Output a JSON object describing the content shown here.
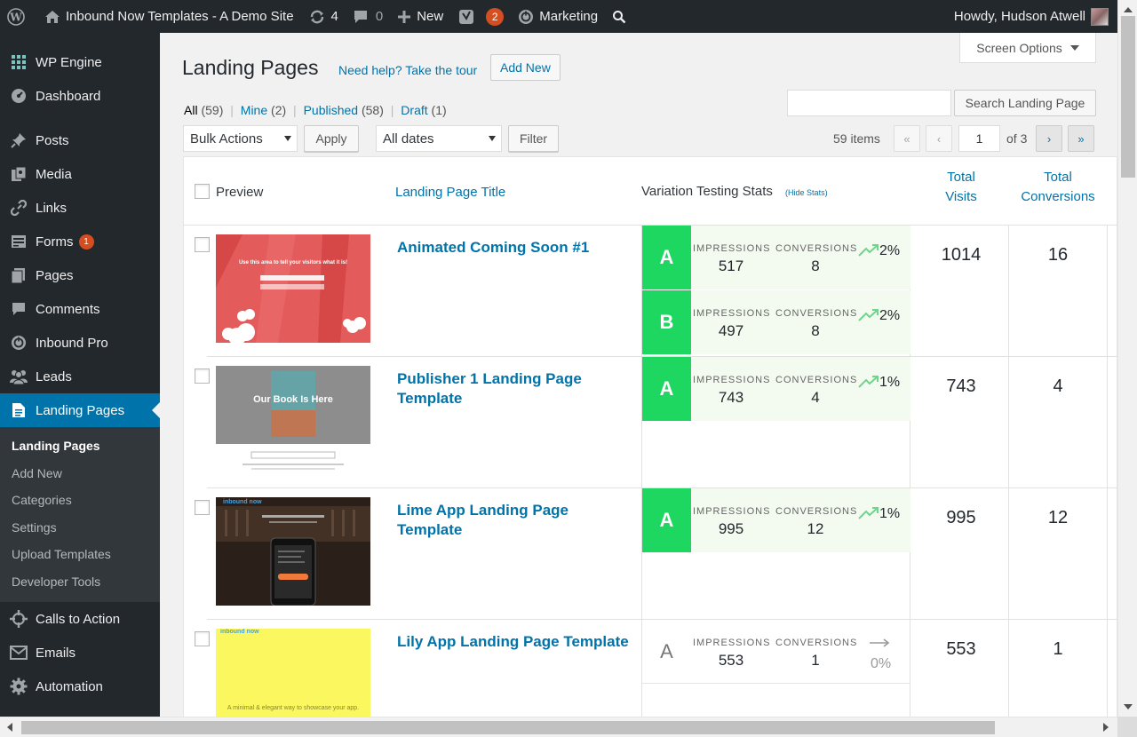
{
  "adminbar": {
    "site_name": "Inbound Now Templates - A Demo Site",
    "updates_count": "4",
    "comments_count": "0",
    "new_label": "New",
    "yoast_badge": "2",
    "marketing_label": "Marketing",
    "howdy": "Howdy, Hudson Atwell"
  },
  "sidebar": {
    "items": [
      {
        "label": "WP Engine",
        "icon": "wpengine-icon"
      },
      {
        "label": "Dashboard",
        "icon": "dashboard-icon"
      },
      {
        "label": "Posts",
        "icon": "pin-icon"
      },
      {
        "label": "Media",
        "icon": "media-icon"
      },
      {
        "label": "Links",
        "icon": "link-icon"
      },
      {
        "label": "Forms",
        "icon": "forms-icon",
        "badge": "1"
      },
      {
        "label": "Pages",
        "icon": "pages-icon"
      },
      {
        "label": "Comments",
        "icon": "comment-icon"
      },
      {
        "label": "Inbound Pro",
        "icon": "inbound-icon"
      },
      {
        "label": "Leads",
        "icon": "users-icon"
      },
      {
        "label": "Landing Pages",
        "icon": "document-icon"
      }
    ],
    "submenu": [
      "Landing Pages",
      "Add New",
      "Categories",
      "Settings",
      "Upload Templates",
      "Developer Tools"
    ],
    "bottom_items": [
      {
        "label": "Calls to Action",
        "icon": "target-icon"
      },
      {
        "label": "Emails",
        "icon": "email-icon"
      },
      {
        "label": "Automation",
        "icon": "gear-icon"
      }
    ]
  },
  "page": {
    "screen_options": "Screen Options",
    "title": "Landing Pages",
    "help": "Need help? Take the tour",
    "add_new": "Add New",
    "filters": {
      "all": "All",
      "all_count": "(59)",
      "mine": "Mine",
      "mine_count": "(2)",
      "published": "Published",
      "published_count": "(58)",
      "draft": "Draft",
      "draft_count": "(1)",
      "sep": "|"
    },
    "search_button": "Search Landing Page",
    "search_value": "",
    "bulk_actions": "Bulk Actions",
    "apply": "Apply",
    "all_dates": "All dates",
    "filter": "Filter",
    "items_count": "59 items",
    "pagination": {
      "first": "«",
      "prev": "‹",
      "current": "1",
      "of": "of 3",
      "next": "›",
      "last": "»"
    }
  },
  "table": {
    "headers": {
      "preview": "Preview",
      "title": "Landing Page Title",
      "stats": "Variation Testing Stats",
      "hide_stats": "(Hide Stats)",
      "visits_1": "Total",
      "visits_2": "Visits",
      "conv_1": "Total",
      "conv_2": "Conversions"
    },
    "impressions_label": "IMPRESSIONS",
    "conversions_label": "CONVERSIONS",
    "rows": [
      {
        "title": "Animated Coming Soon #1",
        "thumb_text": "Use this area to tell your visitors what it is!",
        "visits": "1014",
        "conversions": "16",
        "variations": [
          {
            "letter": "A",
            "impressions": "517",
            "conversions": "8",
            "rate": "2%"
          },
          {
            "letter": "B",
            "impressions": "497",
            "conversions": "8",
            "rate": "2%"
          }
        ]
      },
      {
        "title": "Publisher 1 Landing Page Template",
        "thumb_text": "Our Book Is Here",
        "visits": "743",
        "conversions": "4",
        "variations": [
          {
            "letter": "A",
            "impressions": "743",
            "conversions": "4",
            "rate": "1%"
          }
        ]
      },
      {
        "title": "Lime App Landing Page Template",
        "thumb_text": "inbound now",
        "visits": "995",
        "conversions": "12",
        "variations": [
          {
            "letter": "A",
            "impressions": "995",
            "conversions": "12",
            "rate": "1%"
          }
        ]
      },
      {
        "title": "Lily App Landing Page Template",
        "thumb_text": "A minimal & elegant way to showcase your app.",
        "thumb_logo": "inbound now",
        "visits": "553",
        "conversions": "1",
        "variations": [
          {
            "letter": "A",
            "impressions": "553",
            "conversions": "1",
            "rate": "0%"
          }
        ]
      }
    ]
  },
  "colors": {
    "accent": "#0073aa",
    "variation_green": "#1ed760",
    "adminbar": "#23282d",
    "badge": "#d54e21"
  }
}
